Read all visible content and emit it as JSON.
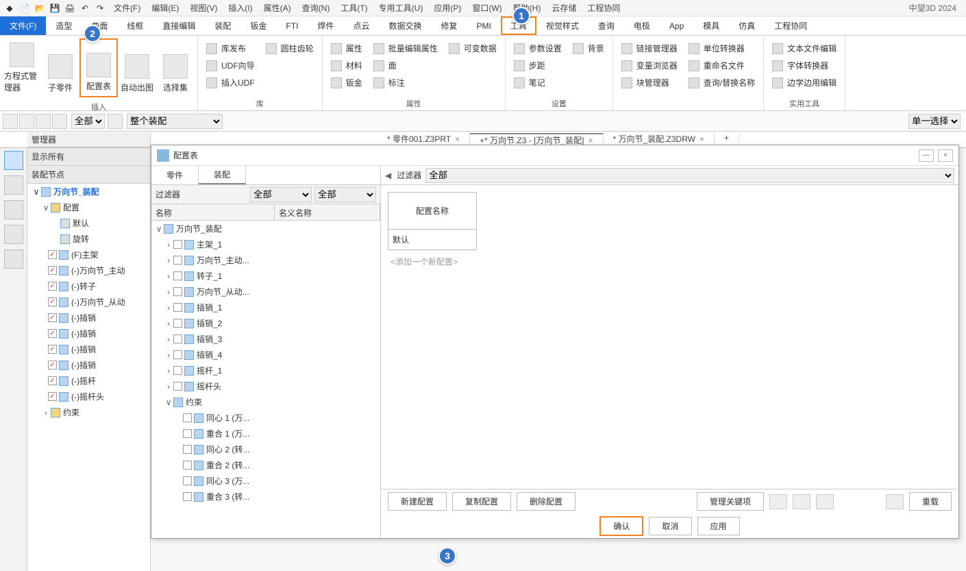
{
  "brand": "中望3D 2024",
  "top_menu": [
    "文件(F)",
    "编辑(E)",
    "视图(V)",
    "插入(I)",
    "属性(A)",
    "查询(N)",
    "工具(T)",
    "专用工具(U)",
    "应用(P)",
    "窗口(W)",
    "帮助(H)",
    "云存储",
    "工程协同"
  ],
  "ribbon_tabs": [
    "文件(F)",
    "造型",
    "曲面",
    "线框",
    "直接编辑",
    "装配",
    "钣金",
    "FTI",
    "焊件",
    "点云",
    "数据交换",
    "修复",
    "PMI",
    "工具",
    "视觉样式",
    "查询",
    "电极",
    "App",
    "模具",
    "仿真",
    "工程协同"
  ],
  "ribbon_active": 0,
  "ribbon_highlight": 13,
  "ribbon_groups": {
    "insert": {
      "label": "插入",
      "btns": [
        "方程式管理器",
        "子零件",
        "配置表",
        "自动出图",
        "选择集"
      ]
    },
    "library": {
      "label": "库",
      "items": [
        "库发布",
        "UDF向导",
        "插入UDF",
        "圆柱齿轮"
      ]
    },
    "attr": {
      "label": "属性",
      "items": [
        "属性",
        "材料",
        "钣金",
        "批量编辑属性",
        "面",
        "标注",
        "可变数据"
      ]
    },
    "settings": {
      "label": "设置",
      "items": [
        "参数设置",
        "步距",
        "笔记",
        "背景"
      ]
    },
    "mgr": {
      "items": [
        "链接管理器",
        "变量浏览器",
        "块管理器",
        "单位转换器",
        "重命名文件",
        "查询/替换名称"
      ]
    },
    "util": {
      "label": "实用工具",
      "items": [
        "文本文件编辑",
        "字体转换器",
        "边学边用编辑"
      ]
    }
  },
  "toolbar2": {
    "sel1": "全部",
    "sel2": "整个装配",
    "sel3": "单一选择"
  },
  "doc_tabs": [
    {
      "label": "* 零件001.Z3PRT",
      "active": false
    },
    {
      "label": "* 万向节.Z3 - [万向节_装配]",
      "active": true
    },
    {
      "label": "* 万向节_装配.Z3DRW",
      "active": false
    }
  ],
  "mgr": {
    "title": "管理器",
    "show_all": "显示所有",
    "section": "装配节点",
    "root": "万向节_装配",
    "config": "配置",
    "config_children": [
      "默认",
      "旋转"
    ],
    "parts": [
      "(F)主架",
      "(-)万向节_主动",
      "(-)转子",
      "(-)万向节_从动",
      "(-)插销",
      "(-)插销",
      "(-)插销",
      "(-)插销",
      "(-)摇杆",
      "(-)摇杆头"
    ],
    "constraint": "约束"
  },
  "dialog": {
    "title": "配置表",
    "tabs": [
      "零件",
      "装配"
    ],
    "active_tab": 1,
    "filter_label": "过滤器",
    "filter1": "全部",
    "filter2": "全部",
    "col1": "名称",
    "col2": "名义名称",
    "left_filter_label": "过滤器",
    "left_filter_val": "全部",
    "root": "万向节_装配",
    "parts": [
      "主架_1",
      "万向节_主动...",
      "转子_1",
      "万向节_从动...",
      "插销_1",
      "插销_2",
      "插销_3",
      "插销_4",
      "摇杆_1",
      "摇杆头"
    ],
    "constraint": "约束",
    "constraints": [
      "同心 1 (万...",
      "重合 1 (万...",
      "同心 2 (转...",
      "重合 2 (转...",
      "同心 3 (万...",
      "重合 3 (转..."
    ],
    "cfg_header": "配置名称",
    "cfg_default": "默认",
    "cfg_add": "<添加一个新配置>",
    "btns": {
      "new": "新建配置",
      "copy": "复制配置",
      "delete": "删除配置",
      "key": "管理关键项",
      "reload": "重载",
      "ok": "确认",
      "cancel": "取消",
      "apply": "应用"
    }
  },
  "badges": {
    "b1": "1",
    "b2": "2",
    "b3": "3"
  }
}
